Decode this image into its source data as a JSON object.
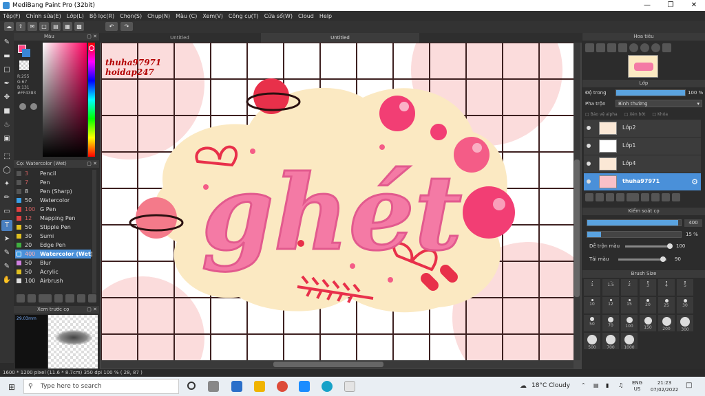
{
  "window": {
    "title": "MediBang Paint Pro (32bit)"
  },
  "menu": [
    "Tệp(F)",
    "Chỉnh sửa(E)",
    "Lớp(L)",
    "Bộ lọc(R)",
    "Chọn(S)",
    "Chụp(N)",
    "Màu (C)",
    "Xem(V)",
    "Công cụ(T)",
    "Cửa sổ(W)",
    "Cloud",
    "Help"
  ],
  "color_panel": {
    "title": "Màu",
    "values": [
      "R:255",
      "G:67",
      "B:131",
      "#FF4383"
    ],
    "colors": {
      "primary": "#ff4383",
      "secondary": "#3a86d6"
    }
  },
  "brush_panel": {
    "title": "Cọ: Watercolor (Wet)",
    "items": [
      {
        "num": "3",
        "name": "Pencil",
        "color": "#555555"
      },
      {
        "num": "7",
        "name": "Pen",
        "color": "#555555"
      },
      {
        "num": "8",
        "name": "Pen (Sharp)",
        "color": "#555555"
      },
      {
        "num": "50",
        "name": "Watercolor",
        "color": "#3aa0e8"
      },
      {
        "num": "100",
        "name": "G Pen",
        "color": "#e04040"
      },
      {
        "num": "12",
        "name": "Mapping Pen",
        "color": "#e04040"
      },
      {
        "num": "50",
        "name": "Stipple Pen",
        "color": "#e0c020"
      },
      {
        "num": "30",
        "name": "Sumi",
        "color": "#e0c020"
      },
      {
        "num": "20",
        "name": "Edge Pen",
        "color": "#40b040"
      },
      {
        "num": "400",
        "name": "Watercolor (Wet)",
        "color": "#3aa0e8"
      },
      {
        "num": "50",
        "name": "Blur",
        "color": "#d080e0"
      },
      {
        "num": "50",
        "name": "Acrylic",
        "color": "#e0c020"
      },
      {
        "num": "100",
        "name": "Airbrush",
        "color": "#dddddd"
      }
    ]
  },
  "preview_panel": {
    "title": "Xem trước cọ",
    "size": "29.03mm"
  },
  "tabs": [
    "Untitled",
    "Untitled"
  ],
  "artwork": {
    "word": "ghét",
    "watermark": [
      "thuha97971",
      "hoidap247"
    ],
    "colors": {
      "blob": "#fbe9c2",
      "pink": "#f47aa5",
      "red": "#e8304a",
      "grid": "#3d2020"
    }
  },
  "navigator": {
    "title": "Hoa tiêu"
  },
  "layer_panel": {
    "title": "Lớp",
    "opacity_label": "Độ trong",
    "opacity_value": "100 %",
    "opacity_fraction": 1.0,
    "blend_label": "Pha trộn",
    "blend_value": "Bình thường",
    "checks": [
      "Bảo vệ alpha",
      "Xén bớt",
      "Khóa"
    ],
    "layers": [
      {
        "name": "Lớp2",
        "selected": false
      },
      {
        "name": "Lớp1",
        "selected": false
      },
      {
        "name": "Lớp4",
        "selected": false
      },
      {
        "name": "thuha97971",
        "selected": true
      }
    ]
  },
  "brush_control": {
    "title": "Kiểm soát cọ",
    "size_value": "400",
    "size_fraction": 0.97,
    "opacity_value": "15 %",
    "opacity_fraction": 0.15,
    "blend_label": "Dễ trộn màu",
    "blend_value": "100",
    "blend_fraction": 1.0,
    "load_label": "Tải màu",
    "load_value": "90",
    "load_fraction": 0.9
  },
  "brush_size": {
    "title": "Brush Size",
    "sizes": [
      "1",
      "1.5",
      "2",
      "3",
      "4",
      "5",
      "10",
      "12",
      "15",
      "20",
      "25",
      "30",
      "50",
      "70",
      "100",
      "150",
      "200",
      "300",
      "500",
      "700",
      "1000"
    ]
  },
  "status": "1600 * 1200 pixel   (11.6 * 8.7cm)   350 dpi   100 %   ( 28, 87 )",
  "taskbar": {
    "search_placeholder": "Type here to search",
    "weather": "18°C  Cloudy",
    "lang": [
      "ENG",
      "US"
    ],
    "time": "21:23",
    "date": "07/02/2022"
  }
}
